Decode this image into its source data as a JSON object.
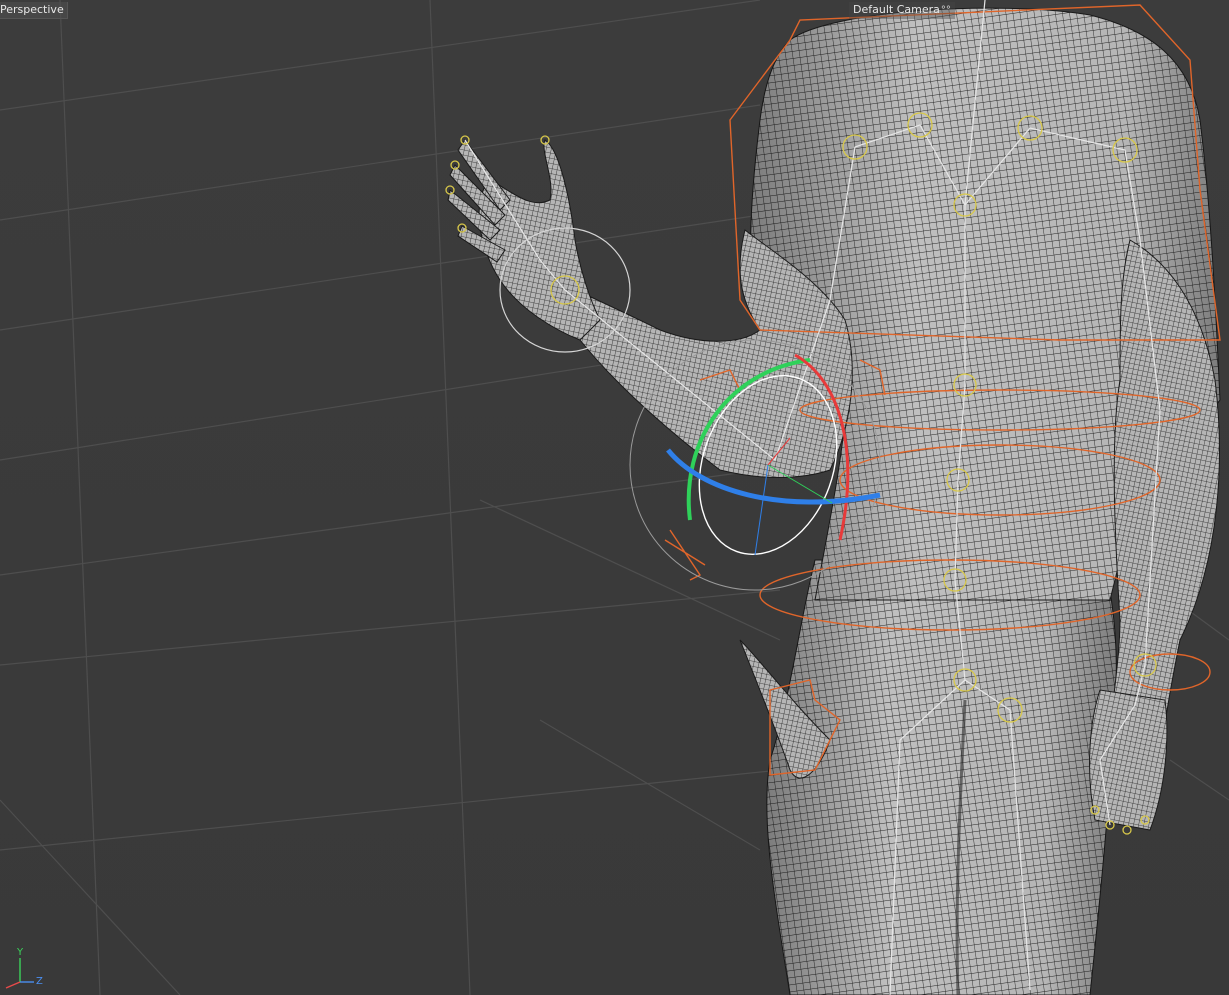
{
  "viewport": {
    "view_name": "Perspective",
    "camera_name": "Default Camera",
    "camera_icon": "°°",
    "colors": {
      "background": "#3b3b3b",
      "grid": "#4d4d4d",
      "mesh_fill": "#bdbdbd",
      "wire": "#2a2a2a",
      "bone": "#e6e6e6",
      "joint": "#d8c84a",
      "controller_orange": "#e0652a",
      "rotate_x": "#e83a3a",
      "rotate_y": "#2fd15a",
      "rotate_z": "#2f7fe8",
      "rotate_view": "#ffffff"
    }
  },
  "axis": {
    "y_label": "Y",
    "z_label": "Z",
    "x_label": "X",
    "y_color": "#3bd35a",
    "z_color": "#4a8ef0",
    "x_color": "#e84a4a"
  }
}
